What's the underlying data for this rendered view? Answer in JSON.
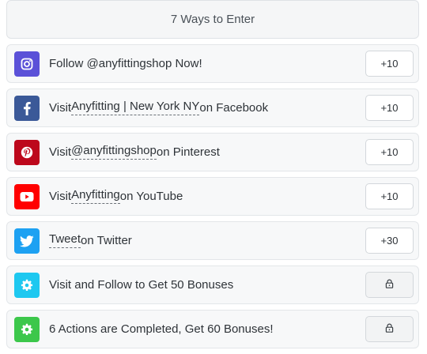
{
  "header": {
    "title": "7 Ways to Enter"
  },
  "entries": [
    {
      "icon": "instagram-icon",
      "color": "#5b51d8",
      "before": "Follow @anyfittingshop Now!",
      "link": "",
      "after": "",
      "points": "+10",
      "locked": false
    },
    {
      "icon": "facebook-icon",
      "color": "#3b5998",
      "before": "Visit ",
      "link": "Anyfitting | New York NY",
      "after": " on Facebook",
      "points": "+10",
      "locked": false
    },
    {
      "icon": "pinterest-icon",
      "color": "#bd081c",
      "before": "Visit ",
      "link": "@anyfittingshop",
      "after": " on Pinterest",
      "points": "+10",
      "locked": false
    },
    {
      "icon": "youtube-icon",
      "color": "#ff0000",
      "before": "Visit ",
      "link": "Anyfitting",
      "after": " on YouTube",
      "points": "+10",
      "locked": false
    },
    {
      "icon": "twitter-icon",
      "color": "#1da1f2",
      "before": "",
      "link": "Tweet",
      "after": " on Twitter",
      "points": "+30",
      "locked": false
    },
    {
      "icon": "gear-icon",
      "color": "#1ec8f0",
      "before": "Visit and Follow to Get 50 Bonuses",
      "link": "",
      "after": "",
      "points": "",
      "locked": true
    },
    {
      "icon": "gear-icon",
      "color": "#3cc74b",
      "before": "6 Actions are Completed, Get 60 Bonuses!",
      "link": "",
      "after": "",
      "points": "",
      "locked": true
    }
  ]
}
